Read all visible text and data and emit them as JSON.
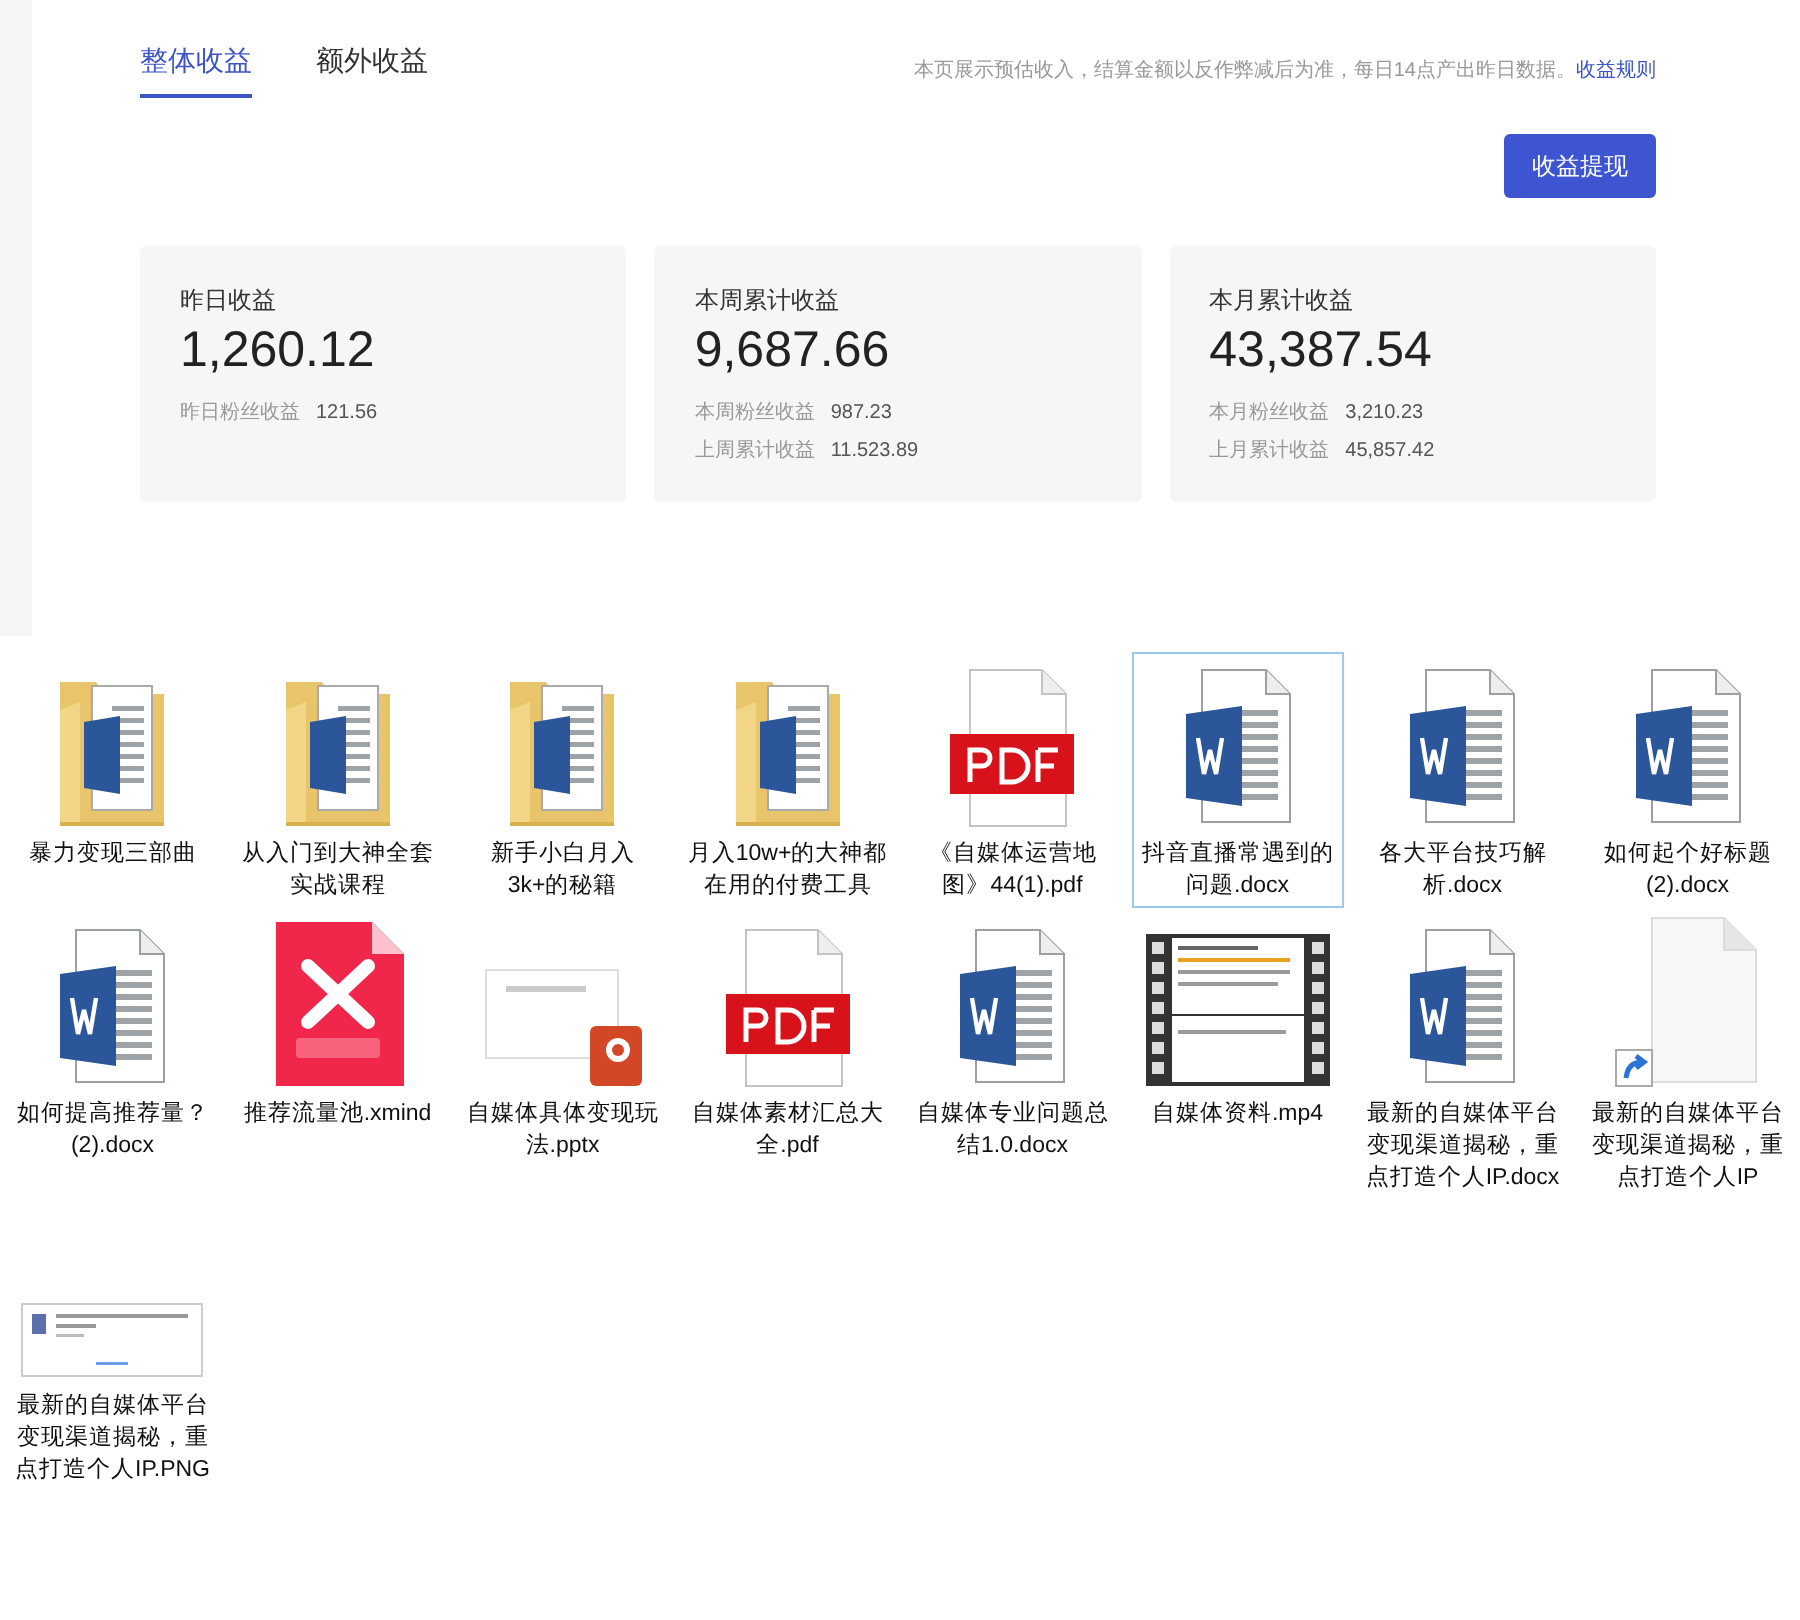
{
  "tabs": [
    {
      "label": "整体收益",
      "selected": true
    },
    {
      "label": "额外收益",
      "selected": false
    }
  ],
  "notice": {
    "text": "本页展示预估收入，结算金额以反作弊减后为准，每日14点产出昨日数据。",
    "link": "收益规则"
  },
  "withdraw_button": "收益提现",
  "cards": [
    {
      "title": "昨日收益",
      "amount": "1,260.12",
      "details": [
        {
          "label": "昨日粉丝收益",
          "value": "121.56"
        }
      ]
    },
    {
      "title": "本周累计收益",
      "amount": "9,687.66",
      "details": [
        {
          "label": "本周粉丝收益",
          "value": "987.23"
        },
        {
          "label": "上周累计收益",
          "value": "11.523.89"
        }
      ]
    },
    {
      "title": "本月累计收益",
      "amount": "43,387.54",
      "details": [
        {
          "label": "本月粉丝收益",
          "value": "3,210.23"
        },
        {
          "label": "上月累计收益",
          "value": "45,857.42"
        }
      ]
    }
  ],
  "files": [
    {
      "kind": "folder",
      "name": "暴力变现三部曲",
      "selected": false
    },
    {
      "kind": "folder",
      "name": "从入门到大神全套实战课程",
      "selected": false
    },
    {
      "kind": "folder",
      "name": "新手小白月入3k+的秘籍",
      "selected": false
    },
    {
      "kind": "folder",
      "name": "月入10w+的大神都在用的付费工具",
      "selected": false
    },
    {
      "kind": "pdf",
      "name": "《自媒体运营地图》44(1).pdf",
      "selected": false
    },
    {
      "kind": "word",
      "name": "抖音直播常遇到的问题.docx",
      "selected": true
    },
    {
      "kind": "word",
      "name": "各大平台技巧解析.docx",
      "selected": false
    },
    {
      "kind": "word",
      "name": "如何起个好标题(2).docx",
      "selected": false
    },
    {
      "kind": "word",
      "name": "如何提高推荐量？(2).docx",
      "selected": false
    },
    {
      "kind": "xmind",
      "name": "推荐流量池.xmind",
      "selected": false
    },
    {
      "kind": "pptx",
      "name": "自媒体具体变现玩法.pptx",
      "selected": false
    },
    {
      "kind": "pdf",
      "name": "自媒体素材汇总大全.pdf",
      "selected": false
    },
    {
      "kind": "word",
      "name": "自媒体专业问题总结1.0.docx",
      "selected": false
    },
    {
      "kind": "video",
      "name": "自媒体资料.mp4",
      "selected": false
    },
    {
      "kind": "word",
      "name": "最新的自媒体平台变现渠道揭秘，重点打造个人IP.docx",
      "selected": false
    },
    {
      "kind": "shortcut",
      "name": "最新的自媒体平台变现渠道揭秘，重点打造个人IP",
      "selected": false
    },
    {
      "kind": "image",
      "name": "最新的自媒体平台变现渠道揭秘，重点打造个人IP.PNG",
      "selected": false
    }
  ]
}
